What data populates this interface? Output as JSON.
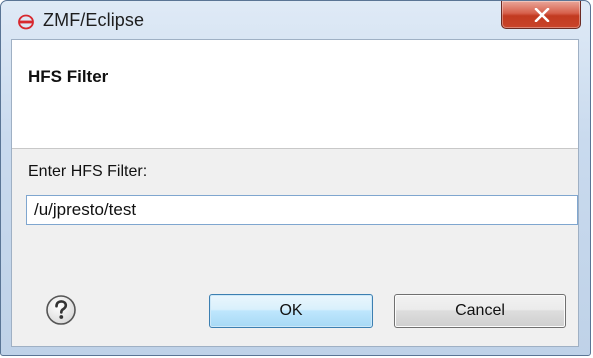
{
  "window": {
    "title": "ZMF/Eclipse",
    "app_icon": "zmf-logo-icon",
    "close_icon": "close-icon"
  },
  "dialog": {
    "header_title": "HFS Filter",
    "field_label": "Enter HFS Filter:",
    "field_value": "/u/jpresto/test"
  },
  "buttons": {
    "help_icon": "help-icon",
    "ok_label": "OK",
    "cancel_label": "Cancel"
  },
  "colors": {
    "app_icon_red": "#d8282e",
    "close_button_red": "#c9442a",
    "default_button_blue": "#3c7fb1",
    "input_border_blue": "#7fa6cf"
  }
}
